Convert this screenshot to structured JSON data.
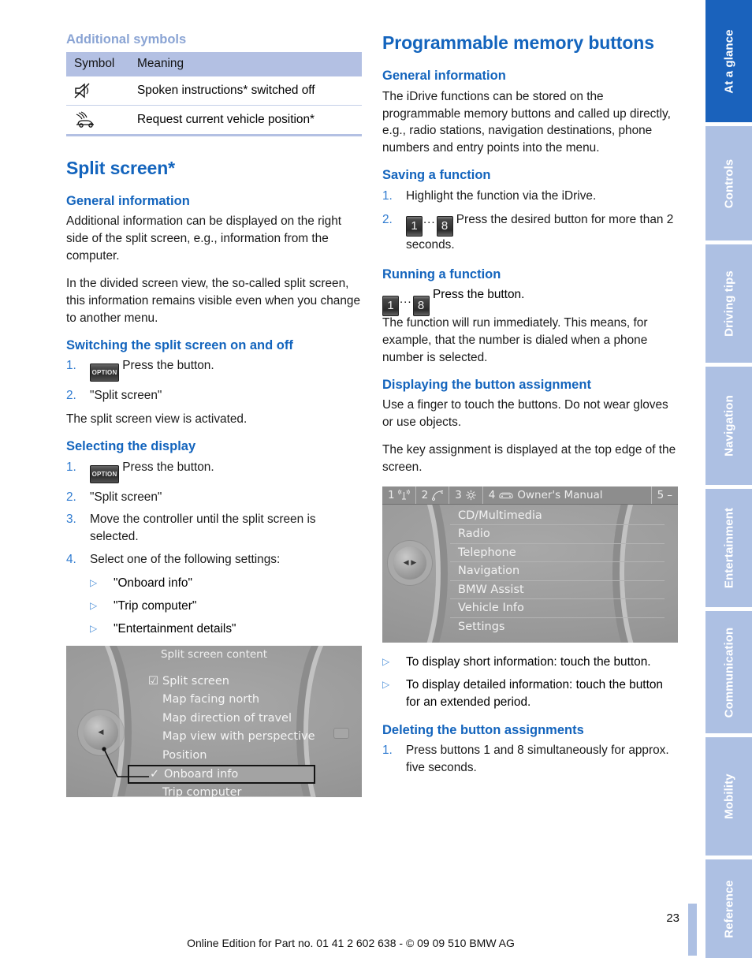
{
  "left_column": {
    "additional_symbols_heading": "Additional symbols",
    "symbol_table": {
      "headers": [
        "Symbol",
        "Meaning"
      ],
      "rows": [
        {
          "icon": "muted-speaker-icon",
          "meaning": "Spoken instructions* switched off"
        },
        {
          "icon": "vehicle-position-icon",
          "meaning": "Request current vehicle position*"
        }
      ]
    },
    "split_screen_title": "Split screen*",
    "general_information_heading": "General information",
    "general_para_1": "Additional information can be displayed on the right side of the split screen, e.g., information from the computer.",
    "general_para_2": "In the divided screen view, the so-called split screen, this information remains visible even when you change to another menu.",
    "switching_heading": "Switching the split screen on and off",
    "switching_steps": [
      {
        "num": "1.",
        "button": "OPTION",
        "text": "Press the button."
      },
      {
        "num": "2.",
        "button": "",
        "text": "\"Split screen\""
      }
    ],
    "switching_result": "The split screen view is activated.",
    "selecting_heading": "Selecting the display",
    "selecting_steps": [
      {
        "num": "1.",
        "button": "OPTION",
        "text": "Press the button."
      },
      {
        "num": "2.",
        "button": "",
        "text": "\"Split screen\""
      },
      {
        "num": "3.",
        "button": "",
        "text": "Move the controller until the split screen is selected."
      },
      {
        "num": "4.",
        "button": "",
        "text": "Select one of the following settings:"
      }
    ],
    "setting_options": [
      "\"Onboard info\"",
      "\"Trip computer\"",
      "\"Entertainment details\""
    ],
    "idrive_left": {
      "header": "Split screen content",
      "items": [
        {
          "label": "Split screen",
          "mark": "checkbox",
          "selected": false
        },
        {
          "label": "Map facing north",
          "mark": "",
          "selected": false
        },
        {
          "label": "Map direction of travel",
          "mark": "",
          "selected": false
        },
        {
          "label": "Map view with perspective",
          "mark": "",
          "selected": false
        },
        {
          "label": "Position",
          "mark": "",
          "selected": false
        },
        {
          "label": "Onboard info",
          "mark": "check",
          "selected": true
        },
        {
          "label": "Trip computer",
          "mark": "",
          "selected": false
        }
      ]
    }
  },
  "right_column": {
    "title": "Programmable memory buttons",
    "general_information_heading": "General information",
    "general_para": "The iDrive functions can be stored on the programmable memory buttons and called up directly, e.g., radio stations, navigation destinations, phone numbers and entry points into the menu.",
    "saving_heading": "Saving a function",
    "saving_steps": [
      {
        "num": "1.",
        "text": "Highlight the function via the iDrive."
      },
      {
        "num": "2.",
        "keys": [
          "1",
          "8"
        ],
        "text": "Press the desired button for more than 2 seconds."
      }
    ],
    "running_heading": "Running a function",
    "running_keys": [
      "1",
      "8"
    ],
    "running_line_1": "Press the button.",
    "running_line_2": "The function will run immediately. This means, for example, that the number is dialed when a phone number is selected.",
    "displaying_heading": "Displaying the button assignment",
    "displaying_para_1": "Use a finger to touch the buttons. Do not wear gloves or use objects.",
    "displaying_para_2": "The key assignment is displayed at the top edge of the screen.",
    "idrive_right": {
      "keybar": [
        {
          "num": "1",
          "icon": "antenna-icon",
          "label": ""
        },
        {
          "num": "2",
          "icon": "phone-icon",
          "label": ""
        },
        {
          "num": "3",
          "icon": "gear-icon",
          "label": ""
        },
        {
          "num": "4",
          "icon": "car-icon",
          "label": "Owner's Manual"
        },
        {
          "num": "5",
          "icon": "",
          "label": "–"
        }
      ],
      "items": [
        "CD/Multimedia",
        "Radio",
        "Telephone",
        "Navigation",
        "BMW Assist",
        "Vehicle Info",
        "Settings"
      ]
    },
    "touch_options": [
      "To display short information: touch the button.",
      "To display detailed information: touch the button for an extended period."
    ],
    "deleting_heading": "Deleting the button assignments",
    "deleting_steps": [
      {
        "num": "1.",
        "text": "Press buttons 1 and 8 simultaneously for approx. five seconds."
      }
    ]
  },
  "sidebar": {
    "tabs": [
      {
        "label": "At a glance",
        "active": true
      },
      {
        "label": "Controls",
        "active": false
      },
      {
        "label": "Driving tips",
        "active": false
      },
      {
        "label": "Navigation",
        "active": false
      },
      {
        "label": "Entertainment",
        "active": false
      },
      {
        "label": "Communication",
        "active": false
      },
      {
        "label": "Mobility",
        "active": false
      },
      {
        "label": "Reference",
        "active": false
      }
    ]
  },
  "footer": {
    "page_number": "23",
    "edition_line": "Online Edition for Part no. 01 41 2 602 638 - © 09 09 510 BMW AG"
  },
  "colors": {
    "heading_blue": "#1364bd",
    "pale_heading_blue": "#8aa4d4",
    "tab_active": "#1a62bc",
    "tab_inactive": "#adc0e3",
    "table_header": "#b3c0e3"
  }
}
